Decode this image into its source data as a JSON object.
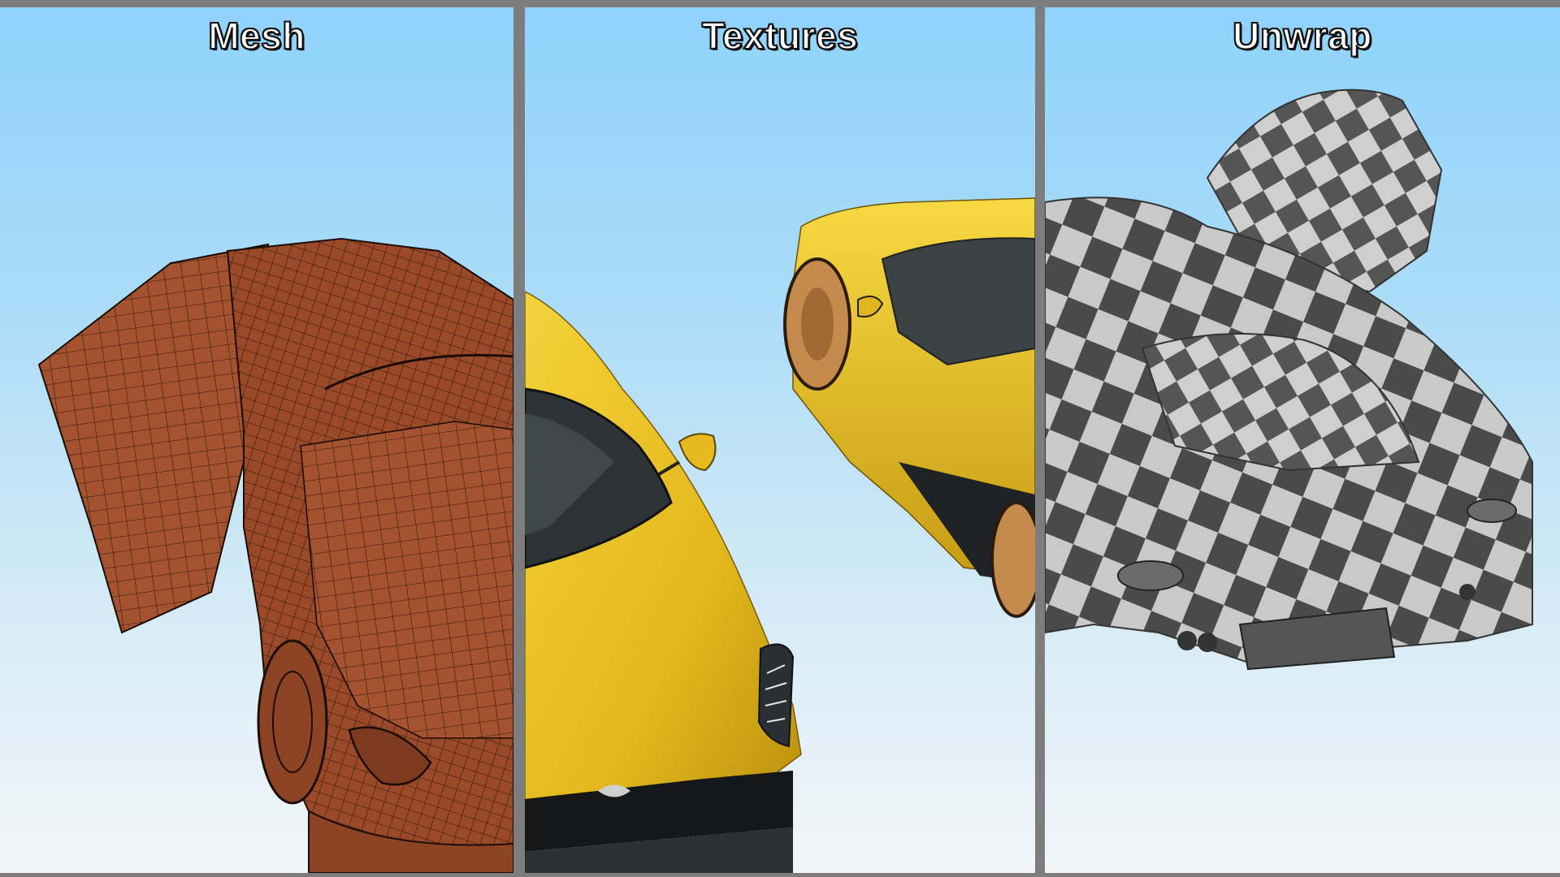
{
  "panels": [
    {
      "id": "mesh",
      "title": "Mesh",
      "render_style": "wireframe",
      "body_color": "#a4522f",
      "wire_color": "#2a140b"
    },
    {
      "id": "textures",
      "title": "Textures",
      "render_style": "shaded",
      "body_color": "#e8bf1e",
      "wheel_color": "#c48a4e"
    },
    {
      "id": "unwrap",
      "title": "Unwrap",
      "render_style": "uv-checker",
      "checker_colors": [
        "#4a4a4a",
        "#c9c9c9"
      ]
    }
  ],
  "colors": {
    "frame": "#7d7d7d",
    "sky_top": "#8fd2fb",
    "sky_bottom": "#f2f6f8"
  }
}
